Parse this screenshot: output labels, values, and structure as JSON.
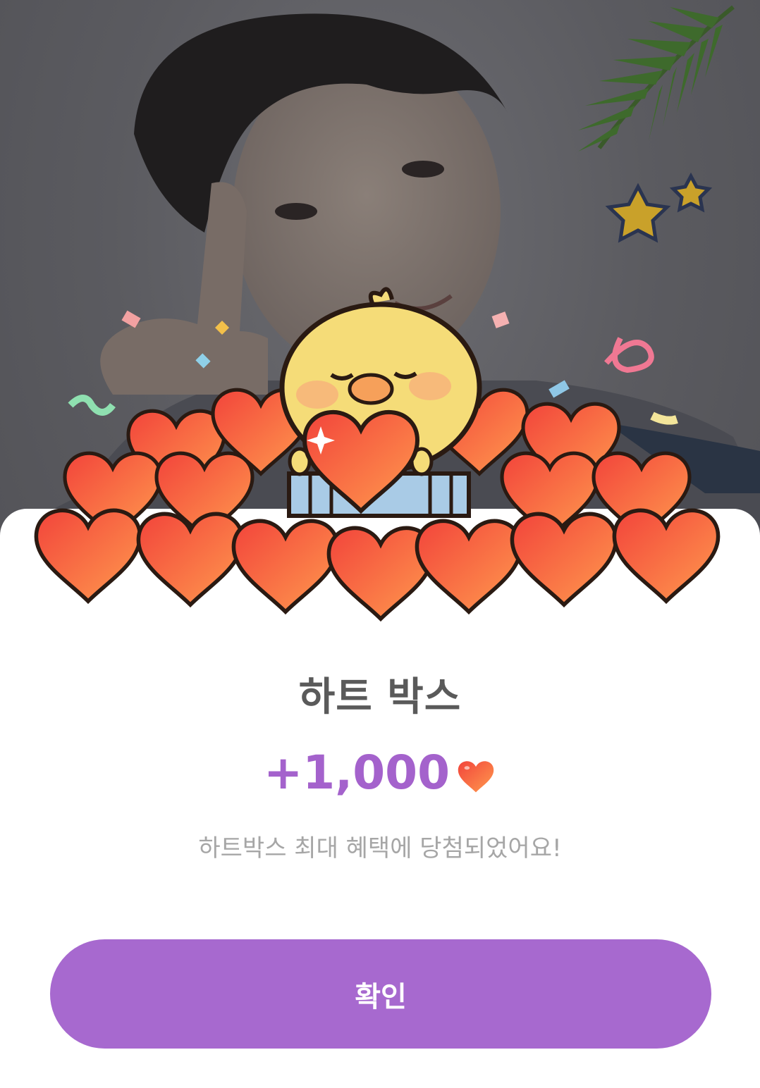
{
  "dialog": {
    "title": "하트 박스",
    "amount": "+1,000",
    "message": "하트박스 최대 혜택에 당첨되었어요!",
    "confirm_label": "확인"
  },
  "colors": {
    "accent": "#a769cf",
    "amount": "#a462cc",
    "heart": "#f4553f"
  },
  "icons": [
    "heart-icon",
    "chick-mascot",
    "palm-leaf-icon",
    "star-icon"
  ]
}
